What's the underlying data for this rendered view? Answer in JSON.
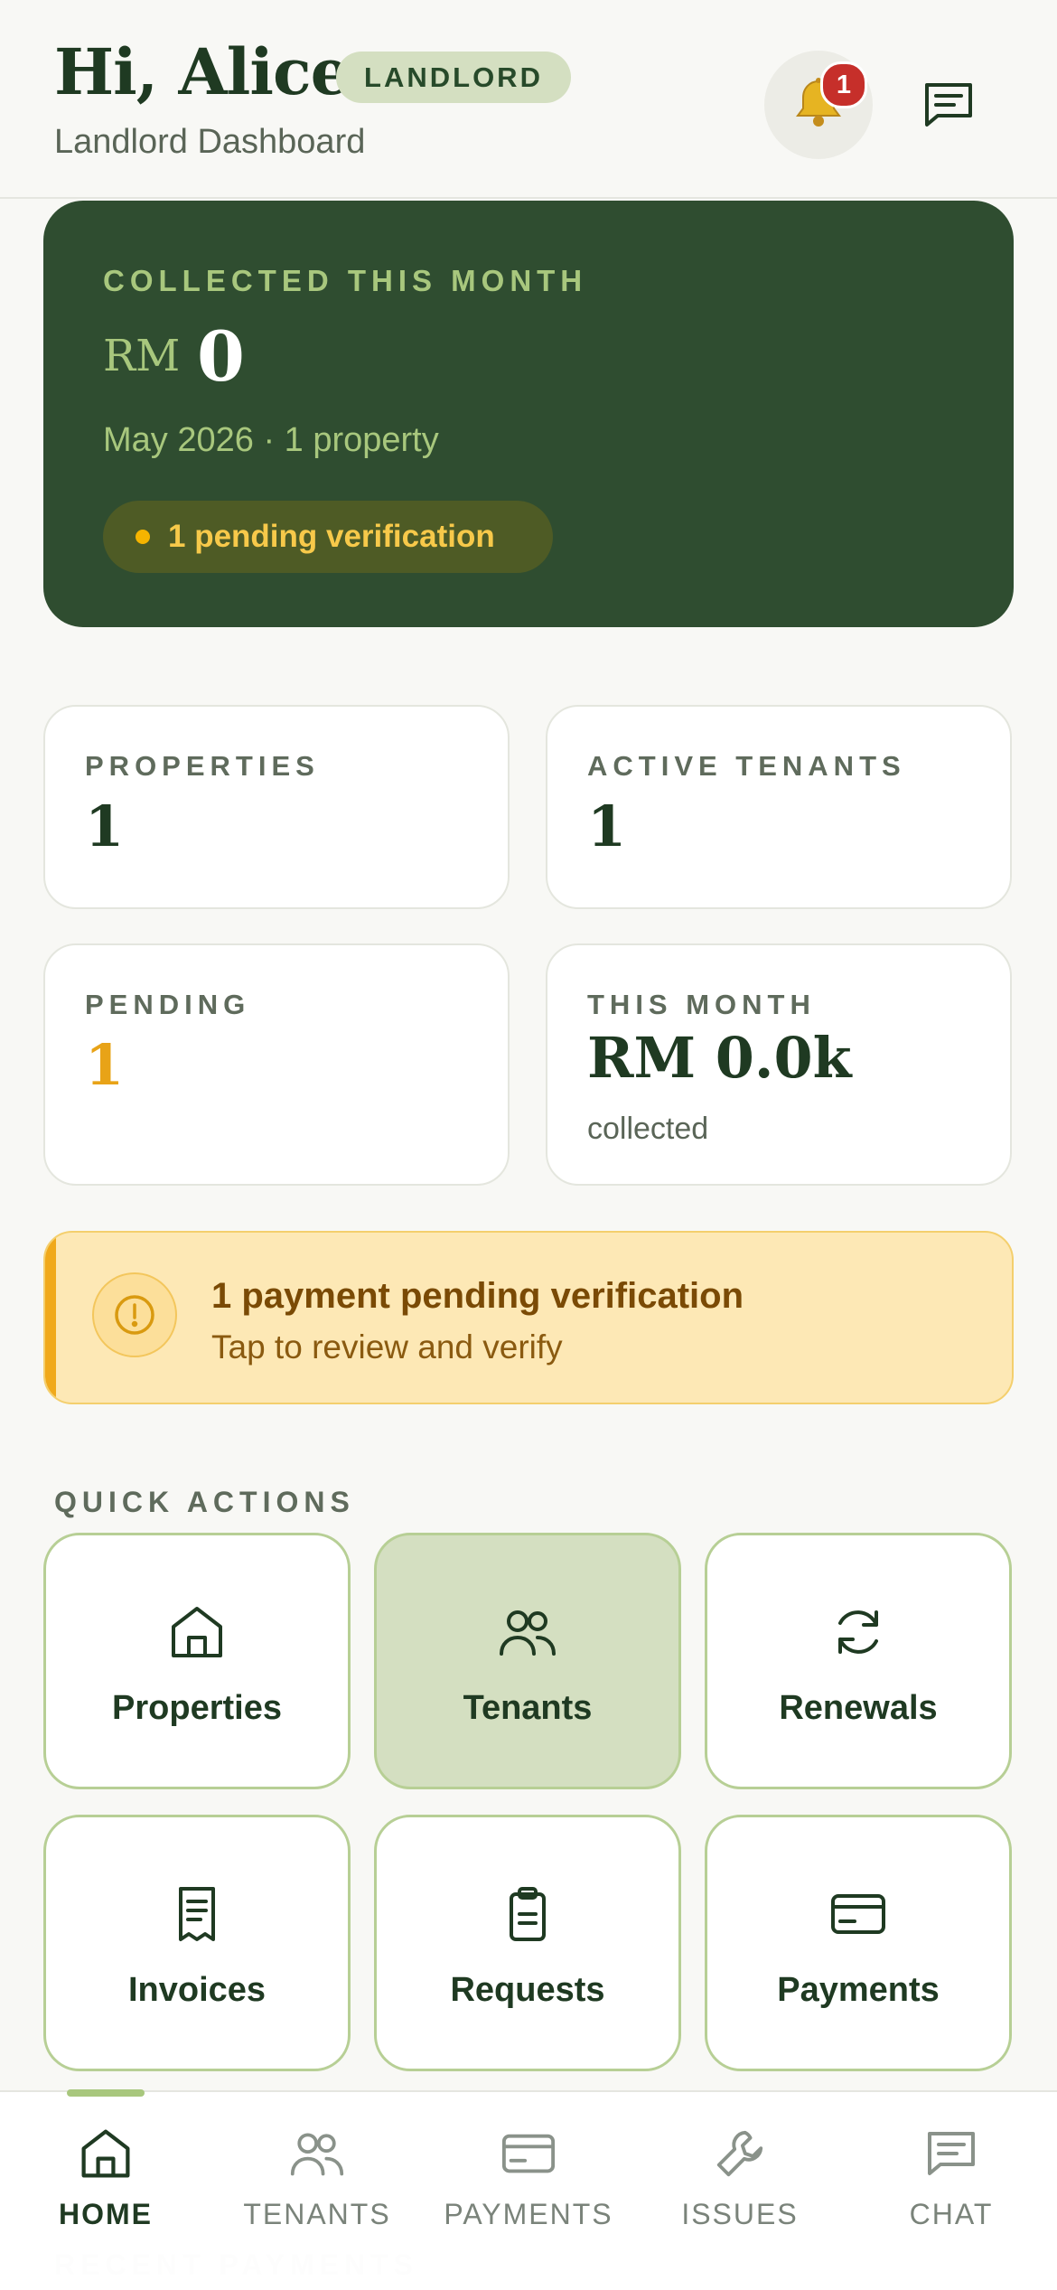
{
  "header": {
    "greeting": "Hi, Alice",
    "role_badge": "LANDLORD",
    "subtitle": "Landlord Dashboard",
    "notification_count": "1",
    "bell_icon": "bell-icon",
    "chat_icon": "chat-icon"
  },
  "hero": {
    "label": "COLLECTED THIS MONTH",
    "currency": "RM",
    "amount": "0",
    "period": "May 2026 · 1 property",
    "pending_pill": "1 pending verification"
  },
  "stats": [
    {
      "label": "PROPERTIES",
      "value": "1",
      "sub": ""
    },
    {
      "label": "ACTIVE TENANTS",
      "value": "1",
      "sub": ""
    },
    {
      "label": "PENDING",
      "value": "1",
      "sub": ""
    },
    {
      "label": "THIS MONTH",
      "value": "RM 0.0k",
      "sub": "collected"
    }
  ],
  "alert": {
    "title": "1 payment pending verification",
    "subtitle": "Tap to review and verify"
  },
  "quick_actions": {
    "heading": "QUICK ACTIONS",
    "items": [
      {
        "label": "Properties",
        "icon": "home-icon"
      },
      {
        "label": "Tenants",
        "icon": "users-icon"
      },
      {
        "label": "Renewals",
        "icon": "refresh-icon"
      },
      {
        "label": "Invoices",
        "icon": "receipt-icon"
      },
      {
        "label": "Requests",
        "icon": "clipboard-icon"
      },
      {
        "label": "Payments",
        "icon": "credit-card-icon"
      }
    ]
  },
  "nav": {
    "items": [
      {
        "label": "HOME",
        "icon": "home-icon"
      },
      {
        "label": "TENANTS",
        "icon": "users-icon"
      },
      {
        "label": "PAYMENTS",
        "icon": "credit-card-icon"
      },
      {
        "label": "ISSUES",
        "icon": "wrench-icon"
      },
      {
        "label": "CHAT",
        "icon": "chat-icon"
      }
    ]
  },
  "colors": {
    "primary": "#2f4d30",
    "accent": "#a8c77d",
    "warning": "#f0a91b",
    "danger": "#c62f2a"
  }
}
